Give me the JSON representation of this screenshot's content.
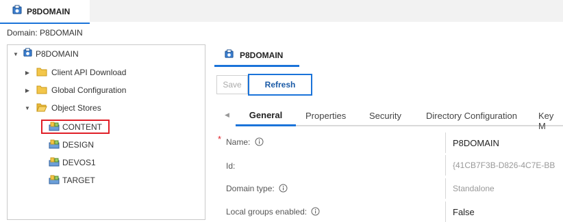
{
  "top_tab": {
    "label": "P8DOMAIN"
  },
  "domain_line": "Domain: P8DOMAIN",
  "tree": {
    "root": {
      "label": "P8DOMAIN"
    },
    "folders": [
      {
        "label": "Client API Download"
      },
      {
        "label": "Global Configuration"
      },
      {
        "label": "Object Stores"
      }
    ],
    "object_stores": [
      {
        "label": "CONTENT"
      },
      {
        "label": "DESIGN"
      },
      {
        "label": "DEVOS1"
      },
      {
        "label": "TARGET"
      }
    ]
  },
  "panel": {
    "title": "P8DOMAIN",
    "save_label": "Save",
    "refresh_label": "Refresh",
    "tabs": [
      {
        "label": "General"
      },
      {
        "label": "Properties"
      },
      {
        "label": "Security"
      },
      {
        "label": "Directory Configuration"
      },
      {
        "label": "Key M"
      }
    ],
    "fields": [
      {
        "label": "Name:",
        "value": "P8DOMAIN"
      },
      {
        "label": "Id:",
        "value": "{41CB7F3B-D826-4C7E-BB"
      },
      {
        "label": "Domain type:",
        "value": "Standalone"
      },
      {
        "label": "Local groups enabled:",
        "value": "False"
      }
    ],
    "required_marker": "*"
  },
  "colors": {
    "accent": "#1a73d9",
    "highlight": "#e01e26",
    "folder": "#f3c64a"
  }
}
